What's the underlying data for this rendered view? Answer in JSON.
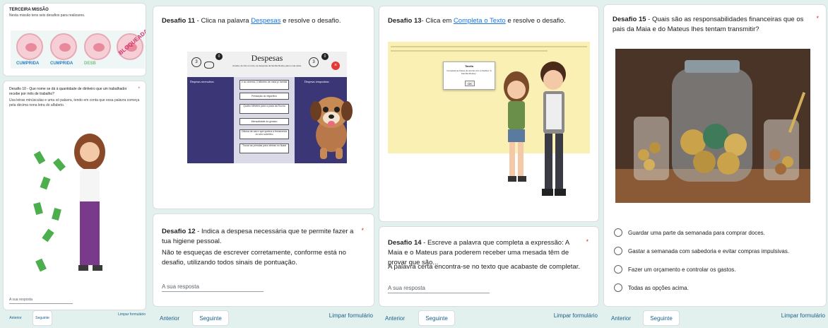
{
  "col1": {
    "mission_title": "TERCEIRA MISSÃO",
    "mission_desc": "Nesta missão tens seis desafios para realizares.",
    "coins": [
      "POUPANÇA",
      "POUPANÇA",
      "POUPANÇA",
      "POUPANÇA"
    ],
    "stamp_labels": [
      "CUMPRIDA",
      "CUMPRIDA",
      "DESB",
      "BLOQUEADA"
    ],
    "q10_title": "Desafio 10 - Que nome se dá à quantidade de dinheiro que um trabalhador recebe por mês de trabalho?",
    "q10_note": "Usa letras minúsculas e uma só palavra, tendo em conta que essa palavra começa pela décima nona letra do alfabeto.",
    "answer_placeholder": "A sua resposta",
    "nav": {
      "prev": "Anterior",
      "next": "Seguinte",
      "clear": "Limpar formulário"
    }
  },
  "col2": {
    "q11_prefix": "Desafio 11",
    "q11_text_before": " - Clica na palavra ",
    "q11_link": "Despesas",
    "q11_text_after": " e resolve o desafio.",
    "game": {
      "title": "Despesas",
      "subtitle": "Arrasta, de três em três, as despesas da família Mosley para a sua caixa.",
      "left_header": "Despesas necessárias",
      "right_header": "Despesas temporárias",
      "counters": [
        "3",
        "0",
        "3",
        "0"
      ],
      "items": [
        "Ir ao cinema; 3 bilhetes de meia p/ família",
        "Prestação do frigorífico",
        "Quatro bilhetes para a praia da Rocha",
        "Mensalidade do ginásio",
        "Oficina de carro que quebra a ferramenta do seu sobrinho",
        "Trocar as prendas para ofertas no Natal"
      ]
    },
    "q12_prefix": "Desafio 12",
    "q12_text": " - Indica a despesa necessária que te permite fazer a tua higiene pessoal.",
    "q12_note": "Não te esqueças de escrever corretamente, conforme está no desafio, utilizando todos sinais de pontuação.",
    "answer_placeholder": "A sua resposta",
    "nav": {
      "prev": "Anterior",
      "next": "Seguinte",
      "clear": "Limpar formulário"
    }
  },
  "col3": {
    "q13_prefix": "Desafio 13",
    "q13_text_before": "- Clica em ",
    "q13_link": "Completa o Texto",
    "q13_text_after": " e resolve o desafio.",
    "dialog": {
      "title": "Tarefa",
      "body": "Completa as frases de acordo com a história \"A Família Mosley\".",
      "ok": "OK"
    },
    "q14_prefix": "Desafio 14",
    "q14_text": " - Escreve a palavra que completa a expressão: A Maia e o Mateus para poderem receber uma mesada têm de provar que são...",
    "q14_note": "A palavra certa encontra-se no texto que acabaste de completar.",
    "answer_placeholder": "A sua resposta",
    "nav": {
      "prev": "Anterior",
      "next": "Seguinte",
      "clear": "Limpar formulário"
    }
  },
  "col4": {
    "q15_prefix": "Desafio 15",
    "q15_text": " - Quais são as responsabilidades financeiras que os pais da Maia e do Mateus lhes tentam transmitir?",
    "options": [
      "Guardar uma parte da semanada para comprar doces.",
      "Gastar a semanada com sabedoria e evitar compras impulsivas.",
      "Fazer um orçamento e controlar os gastos.",
      "Todas as opções acima."
    ],
    "nav": {
      "prev": "Anterior",
      "next": "Seguinte",
      "clear": "Limpar formulário"
    }
  },
  "colors": {
    "background": "#e3f1ee",
    "accent": "#1a73e8",
    "required": "#d93025",
    "nav_text": "#1a5f8a"
  }
}
